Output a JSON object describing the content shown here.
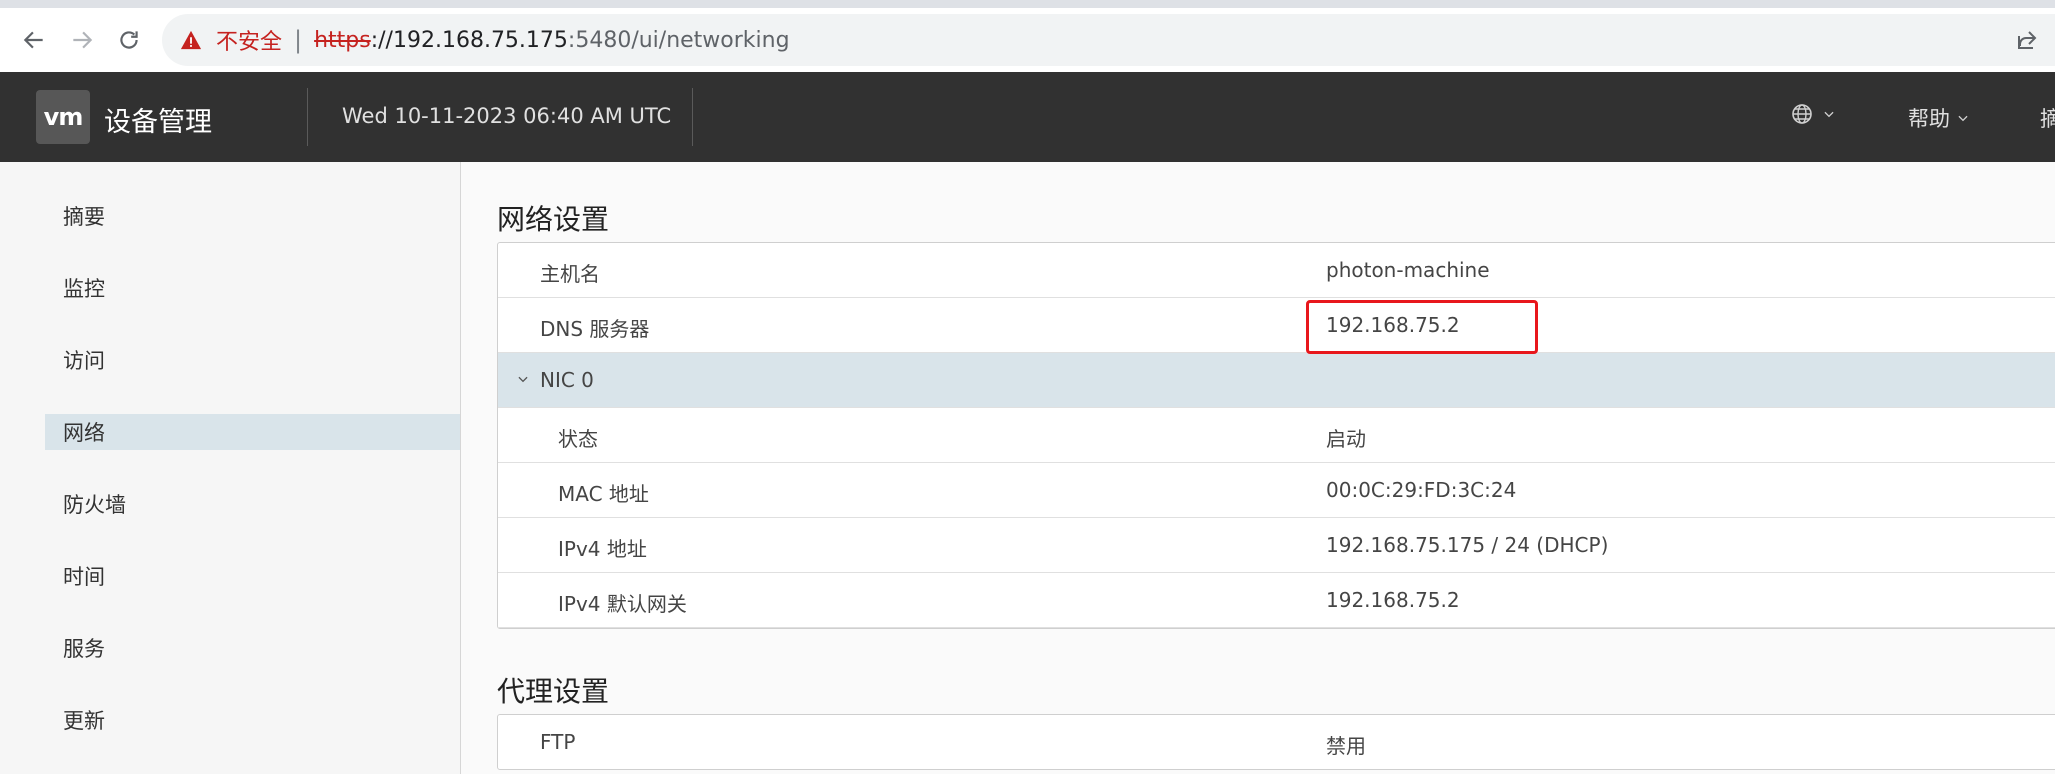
{
  "browser": {
    "security_label": "不安全",
    "url_protocol": "https",
    "url_host": "://192.168.75.175",
    "url_rest": ":5480/ui/networking"
  },
  "header": {
    "logo_text": "vm",
    "app_title": "设备管理",
    "datetime": "Wed 10-11-2023 06:40 AM UTC",
    "help_label": "帮助",
    "cut_item_label": "摘"
  },
  "sidebar": {
    "items": [
      {
        "label": "摘要"
      },
      {
        "label": "监控"
      },
      {
        "label": "访问"
      },
      {
        "label": "网络",
        "active": true
      },
      {
        "label": "防火墙"
      },
      {
        "label": "时间"
      },
      {
        "label": "服务"
      },
      {
        "label": "更新"
      }
    ]
  },
  "network": {
    "title": "网络设置",
    "hostname_label": "主机名",
    "hostname_value": "photon-machine",
    "dns_label": "DNS 服务器",
    "dns_value": "192.168.75.2",
    "nic_label": "NIC 0",
    "status_label": "状态",
    "status_value": "启动",
    "mac_label": "MAC 地址",
    "mac_value": "00:0C:29:FD:3C:24",
    "ipv4_label": "IPv4 地址",
    "ipv4_value": "192.168.75.175 / 24 (DHCP)",
    "gw_label": "IPv4 默认网关",
    "gw_value": "192.168.75.2"
  },
  "proxy": {
    "title": "代理设置",
    "ftp_label": "FTP",
    "ftp_value": "禁用"
  },
  "colors": {
    "header_bg": "#313131",
    "active_bg": "#d9e4ea",
    "highlight": "#e8171c",
    "warning": "#c5221f"
  }
}
